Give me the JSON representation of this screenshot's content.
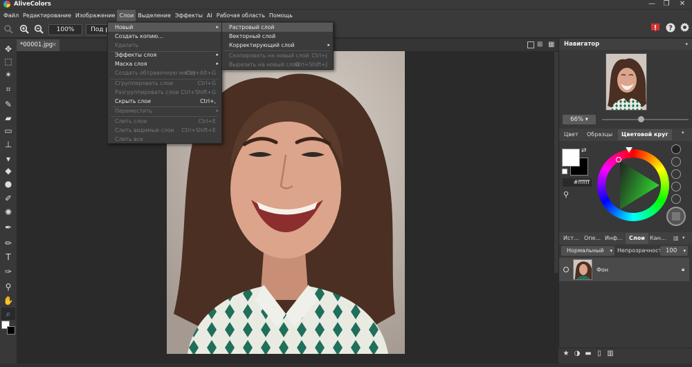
{
  "app": {
    "title": "AliveColors"
  },
  "window_controls": {
    "minimize": "—",
    "restore": "❐",
    "close": "✕"
  },
  "menu": [
    "Файл",
    "Редактирование",
    "Изображение",
    "Слои",
    "Выделение",
    "Эффекты",
    "AI",
    "Рабочая область",
    "Помощь"
  ],
  "options_bar": {
    "zoom_value": "100%",
    "fit_button": "Под р"
  },
  "document": {
    "tab_title": "*00001.jpg",
    "tab_close": "×"
  },
  "layer_menu": {
    "items": [
      {
        "label": "Новый",
        "shortcut": "",
        "submenu": true,
        "disabled": false,
        "highlight": true
      },
      {
        "label": "Создать копию...",
        "shortcut": "",
        "submenu": false,
        "disabled": false
      },
      {
        "label": "Удалить",
        "shortcut": "",
        "submenu": false,
        "disabled": true
      },
      {
        "label": "Эффекты слоя",
        "shortcut": "",
        "submenu": true,
        "disabled": false
      },
      {
        "label": "Маска слоя",
        "shortcut": "",
        "submenu": true,
        "disabled": false
      },
      {
        "label": "Создать обтравочную маску",
        "shortcut": "Ctrl+Alt+G",
        "submenu": false,
        "disabled": true
      },
      {
        "label": "Сгруппировать слои",
        "shortcut": "Ctrl+G",
        "submenu": false,
        "disabled": true
      },
      {
        "label": "Разгруппировать слои",
        "shortcut": "Ctrl+Shift+G",
        "submenu": false,
        "disabled": true
      },
      {
        "label": "Скрыть слои",
        "shortcut": "Ctrl+,",
        "submenu": false,
        "disabled": false
      },
      {
        "label": "Переместить",
        "shortcut": "",
        "submenu": true,
        "disabled": true
      },
      {
        "label": "Слить слои",
        "shortcut": "Ctrl+E",
        "submenu": false,
        "disabled": true
      },
      {
        "label": "Слить видимые слои",
        "shortcut": "Ctrl+Shift+E",
        "submenu": false,
        "disabled": true
      },
      {
        "label": "Слить все",
        "shortcut": "",
        "submenu": false,
        "disabled": true
      }
    ]
  },
  "new_submenu": {
    "items": [
      {
        "label": "Растровый слой",
        "shortcut": "",
        "submenu": false,
        "disabled": false,
        "highlight": true
      },
      {
        "label": "Векторный слой",
        "shortcut": "",
        "submenu": false,
        "disabled": false
      },
      {
        "label": "Корректирующий слой",
        "shortcut": "",
        "submenu": true,
        "disabled": false
      },
      {
        "label": "Скопировать на новый слой",
        "shortcut": "Ctrl+J",
        "submenu": false,
        "disabled": true
      },
      {
        "label": "Вырезать на новый слой",
        "shortcut": "Ctrl+Shift+J",
        "submenu": false,
        "disabled": true
      }
    ]
  },
  "navigator": {
    "title": "Навигатор",
    "zoom": "66%"
  },
  "color_panel": {
    "tabs": [
      "Цвет",
      "Образцы",
      "Цветовой круг"
    ],
    "active_tab": 2,
    "hex": "#ffffff",
    "foreground": "#ffffff",
    "background": "#000000"
  },
  "layers_panel": {
    "tabs": [
      "Ист...",
      "Опе...",
      "Инф...",
      "Слои",
      "Кан..."
    ],
    "active_tab": 3,
    "blend_mode": "Нормальный",
    "opacity_label": "Непрозрачность",
    "opacity_value": "100",
    "layers": [
      {
        "name": "Фон",
        "visible": true,
        "locked": true
      }
    ]
  },
  "tools": [
    "move",
    "marquee",
    "magic-wand",
    "crop",
    "brush",
    "eraser",
    "gradient",
    "stamp",
    "drop",
    "dodge",
    "smudge",
    "patch",
    "brush-alt",
    "pen-alt",
    "text",
    "pen",
    "eyedropper",
    "hand",
    "zoom"
  ]
}
